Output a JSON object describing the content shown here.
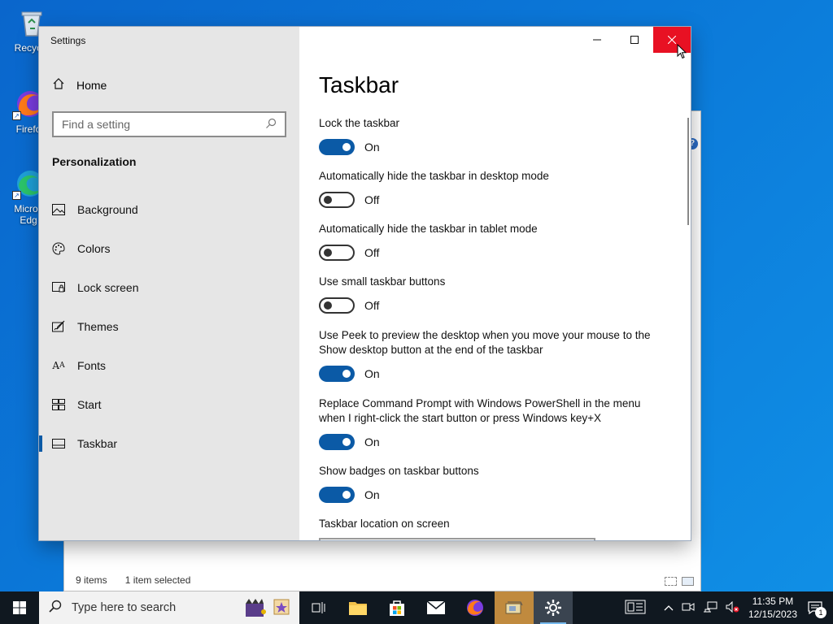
{
  "desktop": {
    "icons": [
      {
        "label": "Recycle",
        "icon": "recycle-bin-icon"
      },
      {
        "label": "Firefo",
        "icon": "firefox-icon"
      },
      {
        "label": "Micros Edg",
        "icon": "edge-icon"
      }
    ]
  },
  "explorer": {
    "status_items": "9 items",
    "status_selected": "1 item selected"
  },
  "settings": {
    "window_title": "Settings",
    "home_label": "Home",
    "search_placeholder": "Find a setting",
    "section": "Personalization",
    "nav": [
      {
        "label": "Background",
        "icon": "background-picture-icon"
      },
      {
        "label": "Colors",
        "icon": "palette-icon"
      },
      {
        "label": "Lock screen",
        "icon": "lock-screen-icon"
      },
      {
        "label": "Themes",
        "icon": "themes-brush-icon"
      },
      {
        "label": "Fonts",
        "icon": "fonts-icon"
      },
      {
        "label": "Start",
        "icon": "start-grid-icon"
      },
      {
        "label": "Taskbar",
        "icon": "taskbar-icon",
        "active": true
      }
    ],
    "page_title": "Taskbar",
    "options": [
      {
        "label": "Lock the taskbar",
        "state": "On"
      },
      {
        "label": "Automatically hide the taskbar in desktop mode",
        "state": "Off"
      },
      {
        "label": "Automatically hide the taskbar in tablet mode",
        "state": "Off"
      },
      {
        "label": "Use small taskbar buttons",
        "state": "Off"
      },
      {
        "label": "Use Peek to preview the desktop when you move your mouse to the Show desktop button at the end of the taskbar",
        "state": "On"
      },
      {
        "label": "Replace Command Prompt with Windows PowerShell in the menu when I right-click the start button or press Windows key+X",
        "state": "On"
      },
      {
        "label": "Show badges on taskbar buttons",
        "state": "On"
      }
    ],
    "location_label": "Taskbar location on screen"
  },
  "taskbar": {
    "search_placeholder": "Type here to search",
    "time": "11:35 PM",
    "date": "12/15/2023",
    "notification_count": "1"
  },
  "colors": {
    "accent": "#0b5aa6",
    "close_red": "#e81123",
    "sidebar_bg": "#e6e6e6",
    "taskbar_bg": "#101820"
  }
}
